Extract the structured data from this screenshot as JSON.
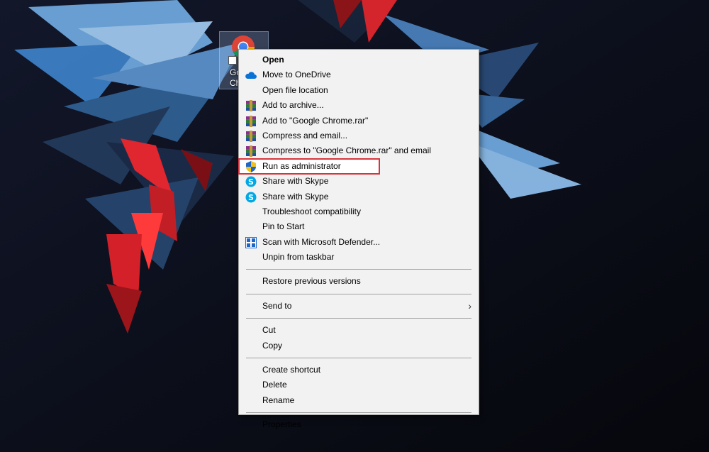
{
  "desktop_icon": {
    "label_line1": "Google",
    "label_line2": "Chrome"
  },
  "menu": {
    "group1": [
      {
        "label": "Open",
        "icon": "none",
        "bold": true
      },
      {
        "label": "Move to OneDrive",
        "icon": "onedrive-icon"
      },
      {
        "label": "Open file location",
        "icon": "none"
      },
      {
        "label": "Add to archive...",
        "icon": "winrar-icon"
      },
      {
        "label": "Add to \"Google Chrome.rar\"",
        "icon": "winrar-icon"
      },
      {
        "label": "Compress and email...",
        "icon": "winrar-icon"
      },
      {
        "label": "Compress to \"Google Chrome.rar\" and email",
        "icon": "winrar-icon"
      },
      {
        "label": "Run as administrator",
        "icon": "uac-shield-icon",
        "highlighted": true
      },
      {
        "label": "Share with Skype",
        "icon": "skype-icon"
      },
      {
        "label": "Share with Skype",
        "icon": "skype-icon"
      },
      {
        "label": "Troubleshoot compatibility",
        "icon": "none"
      },
      {
        "label": "Pin to Start",
        "icon": "none"
      },
      {
        "label": "Scan with Microsoft Defender...",
        "icon": "defender-icon"
      },
      {
        "label": "Unpin from taskbar",
        "icon": "none"
      }
    ],
    "group2": [
      {
        "label": "Restore previous versions"
      }
    ],
    "group3": [
      {
        "label": "Send to",
        "submenu": true
      }
    ],
    "group4": [
      {
        "label": "Cut"
      },
      {
        "label": "Copy"
      }
    ],
    "group5": [
      {
        "label": "Create shortcut"
      },
      {
        "label": "Delete"
      },
      {
        "label": "Rename"
      }
    ],
    "group6": [
      {
        "label": "Properties"
      }
    ]
  },
  "colors": {
    "menu_bg": "#f2f2f2",
    "highlight_border": "#d8343d",
    "wallpaper_bg": "#0b0d16",
    "accent_blue": "#3f8fd8",
    "accent_red": "#e0262e"
  }
}
